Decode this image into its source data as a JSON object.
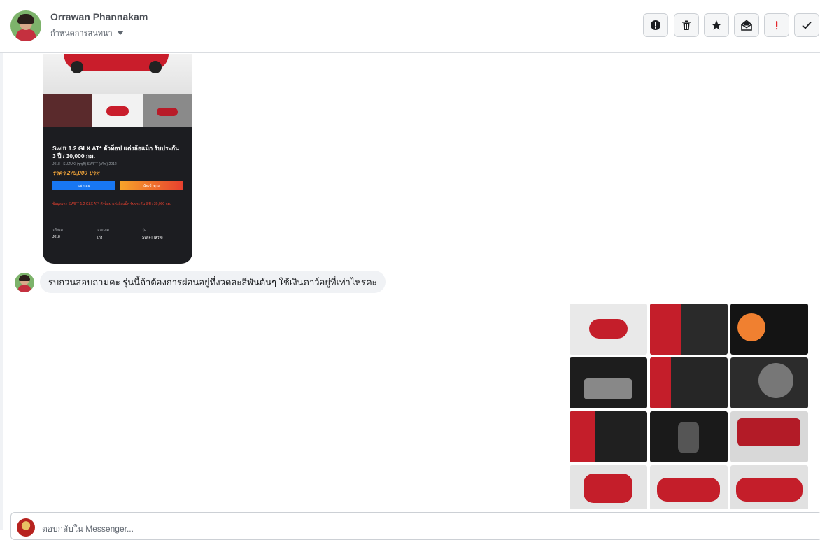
{
  "contact": {
    "name": "Orrawan Phannakam",
    "assign_label": "กำหนดการสนทนา"
  },
  "toolbar": {
    "icons": [
      "alert-circle-icon",
      "trash-icon",
      "star-icon",
      "mark-unread-icon",
      "spam-icon",
      "check-icon"
    ]
  },
  "shared_post": {
    "title": "Swift 1.2 GLX AT* ตัวท็อป แต่งล้อแม็ก รับประกัน 3 ปี / 30,000 กม.",
    "subtitle": "J018 - SUZUKI (ซูซูกิ) SWIFT (สวิฟ) 2012",
    "price": "ราคา 279,000 บาท",
    "primary_button": "แชทเลย",
    "secondary_button": "นัดเข้าดูรถ",
    "note": "ข้อมูลรถ : SWIFT 1.2 GLX AT* ตัวท็อป แต่งล้อแม็ก รับประกัน 3 ปี / 30,000 กม.",
    "specs": [
      {
        "label": "รหัสรถ",
        "value": "J018"
      },
      {
        "label": "ประเภท",
        "value": "เก๋ง"
      },
      {
        "label": "รุ่น",
        "value": "SWIFT (สวิฟ)"
      }
    ]
  },
  "message": {
    "text": "รบกวนสอบถามคะ รุ่นนี้ถ้าต้องการผ่อนอยู่ที่งวดละสี่พันต้นๆ ใช้เงินดาว์อยู่ที่เท่าไหร่คะ"
  },
  "photos": [
    {
      "name": "car-front-photo",
      "bg": "#e9e9e9",
      "accent": "#c41e2a"
    },
    {
      "name": "door-panel-photo",
      "bg": "#2a2a2a",
      "accent": "#c41e2a"
    },
    {
      "name": "gauge-cluster-photo",
      "bg": "#141414",
      "accent": "#f08030"
    },
    {
      "name": "dashboard-photo",
      "bg": "#1d1d1d",
      "accent": "#888888"
    },
    {
      "name": "front-seats-photo",
      "bg": "#262626",
      "accent": "#c41e2a"
    },
    {
      "name": "steering-wheel-photo",
      "bg": "#2c2c2c",
      "accent": "#777777"
    },
    {
      "name": "rear-seats-photo",
      "bg": "#202020",
      "accent": "#c41e2a"
    },
    {
      "name": "gear-shifter-photo",
      "bg": "#1a1a1a",
      "accent": "#555555"
    },
    {
      "name": "engine-bay-photo",
      "bg": "#d8d8d8",
      "accent": "#b31b27"
    },
    {
      "name": "car-rear-photo",
      "bg": "#e4e4e4",
      "accent": "#c41e2a"
    },
    {
      "name": "car-side-photo",
      "bg": "#e6e6e6",
      "accent": "#c41e2a"
    },
    {
      "name": "car-profile-photo",
      "bg": "#e1e1e1",
      "accent": "#c41e2a"
    }
  ],
  "composer": {
    "placeholder": "ตอบกลับใน Messenger..."
  }
}
